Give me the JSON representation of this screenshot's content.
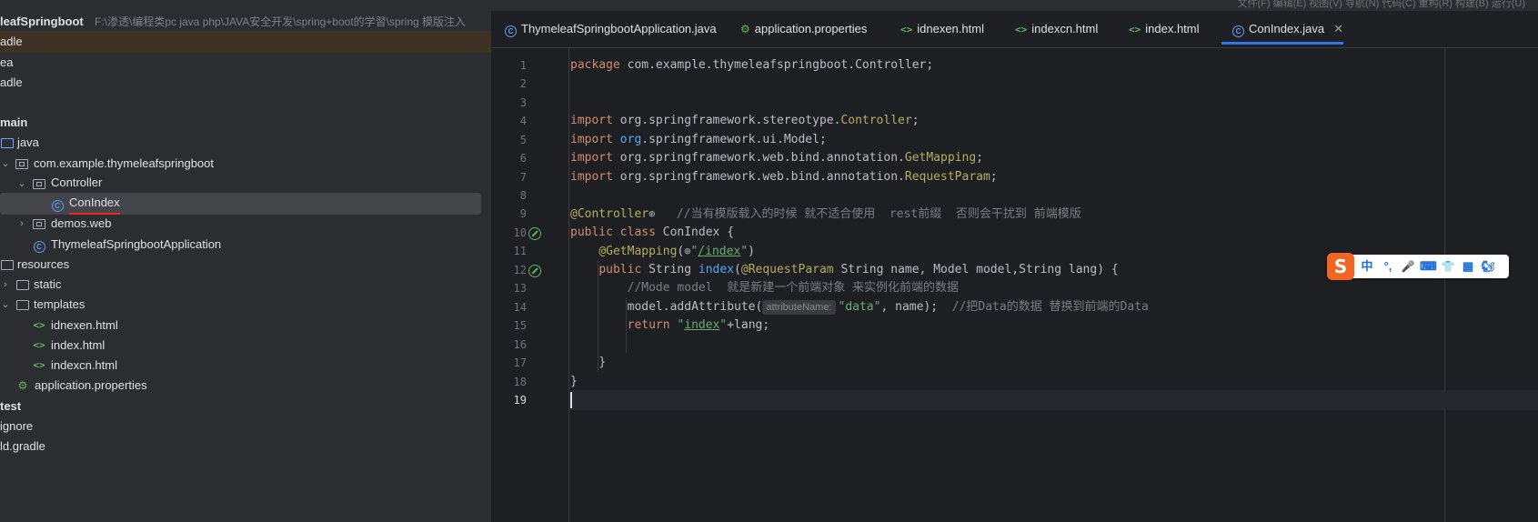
{
  "topbar": {
    "right_text": "文件(F) 编辑(E) 视图(V) 导航(N) 代码(C) 重构(R) 构建(B) 运行(U)"
  },
  "tree": {
    "root_name": "leafSpringboot",
    "root_path": "F:\\渗透\\编程类pc java php\\JAVA安全开发\\spring+boot的学習\\spring 模版注入",
    "items": [
      {
        "label": "adle"
      },
      {
        "label": "ea"
      },
      {
        "label": "adle"
      },
      {
        "label": "main"
      },
      {
        "label": "java"
      },
      {
        "label": "com.example.thymeleafspringboot"
      },
      {
        "label": "Controller"
      },
      {
        "label": "ConIndex"
      },
      {
        "label": "demos.web"
      },
      {
        "label": "ThymeleafSpringbootApplication"
      },
      {
        "label": "resources"
      },
      {
        "label": "static"
      },
      {
        "label": "templates"
      },
      {
        "label": "idnexen.html"
      },
      {
        "label": "index.html"
      },
      {
        "label": "indexcn.html"
      },
      {
        "label": "application.properties"
      },
      {
        "label": "test"
      },
      {
        "label": "ignore"
      },
      {
        "label": "ld.gradle"
      }
    ]
  },
  "tabs": [
    {
      "label": "ThymeleafSpringbootApplication.java",
      "icon": "class-icon"
    },
    {
      "label": "application.properties",
      "icon": "properties-icon"
    },
    {
      "label": "idnexen.html",
      "icon": "html-icon"
    },
    {
      "label": "indexcn.html",
      "icon": "html-icon"
    },
    {
      "label": "index.html",
      "icon": "html-icon"
    },
    {
      "label": "ConIndex.java",
      "icon": "class-icon",
      "active": true
    }
  ],
  "code": {
    "line_numbers": [
      "1",
      "2",
      "3",
      "4",
      "5",
      "6",
      "7",
      "8",
      "9",
      "10",
      "11",
      "12",
      "13",
      "14",
      "15",
      "16",
      "17",
      "18",
      "19"
    ],
    "l1_kw": "package",
    "l1_rest": " com.example.thymeleafspringboot.Controller;",
    "imp_kw": "import",
    "l4_pkg": " org.springframework.stereotype.",
    "l4_cls": "Controller",
    "l4_end": ";",
    "l5_pre": " ",
    "l5_org": "org",
    "l5_rest": ".springframework.ui.Model;",
    "l6_pkg": " org.springframework.web.bind.annotation.",
    "l6_cls": "GetMapping",
    "l6_end": ";",
    "l7_pkg": " org.springframework.web.bind.annotation.",
    "l7_cls": "RequestParam",
    "l7_end": ";",
    "l9_ann": "@Controller",
    "l9_globe": "⊕",
    "l9_comment": "//当有模版载入的时候 就不适合使用  rest前缀  否则会干扰到 前端模版",
    "l10_kw": "public class",
    "l10_rest": " ConIndex {",
    "l11_ann": "@GetMapping",
    "l11_open": "(",
    "l11_globe": "⊕",
    "l11_q1": "\"",
    "l11_path": "/index",
    "l11_q2": "\"",
    "l11_close": ")",
    "l12_kw": "public",
    "l12_type": " String ",
    "l12_fn": "index",
    "l12_open": "(",
    "l12_ann": "@RequestParam",
    "l12_rest": " String name, Model model,String lang) {",
    "l13_comment": "//Mode model  就是新建一个前端对象 来实例化前端的数据",
    "l14_pre": "model.addAttribute(",
    "l14_hint": "attributeName:",
    "l14_str": "\"data\"",
    "l14_rest": ", name);  ",
    "l14_comment": "//把Data的数据 替换到前端的Data",
    "l15_kw": "return",
    "l15_sp": " ",
    "l15_q1": "\"",
    "l15_str": "index",
    "l15_q2": "\"",
    "l15_rest": "+lang;",
    "l17": "}",
    "l18": "}"
  },
  "ime": {
    "logo": "S",
    "items": [
      "中",
      "°,",
      "🎤",
      "⌨",
      "👕",
      "▦",
      "🐿"
    ]
  }
}
